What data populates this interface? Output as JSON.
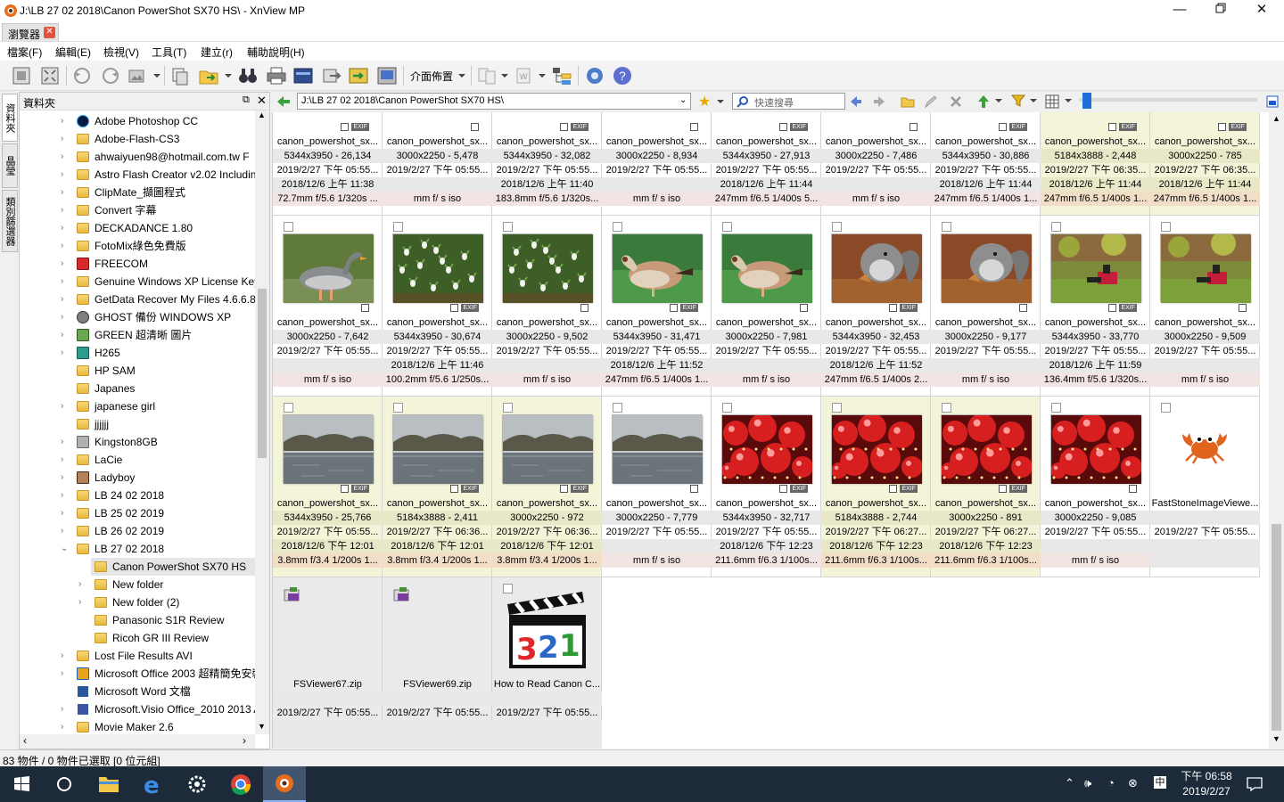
{
  "window": {
    "title": "J:\\LB 27 02 2018\\Canon PowerShot SX70 HS\\ - XnView MP",
    "minimize_icon": "minimize-icon",
    "maximize_icon": "restore-icon",
    "close_icon": "close-icon"
  },
  "tabs": [
    {
      "label": "瀏覽器",
      "close": "✕"
    }
  ],
  "menu": [
    "檔案(F)",
    "編輯(E)",
    "檢視(V)",
    "工具(T)",
    "建立(r)",
    "輔助說明(H)"
  ],
  "toolbar": {
    "layout_label": "介面佈置"
  },
  "side_tabs": [
    "資料夾",
    "晶瑩",
    "類別篩選器"
  ],
  "folder_panel": {
    "title": "資料夾",
    "items": [
      {
        "label": "Adobe Photoshop  CC",
        "icon": "ps-icon",
        "depth": 0,
        "arrow": "›"
      },
      {
        "label": "Adobe-Flash-CS3",
        "icon": "folder-icon",
        "depth": 0,
        "arrow": "›"
      },
      {
        "label": "ahwaiyuen98@hotmail.com.tw  F",
        "icon": "folder-icon",
        "depth": 0,
        "arrow": "›"
      },
      {
        "label": "Astro Flash Creator v2.02  Includin",
        "icon": "folder-icon",
        "depth": 0,
        "arrow": "›"
      },
      {
        "label": "ClipMate_擷圖程式",
        "icon": "folder-icon",
        "depth": 0,
        "arrow": "›"
      },
      {
        "label": "Convert 字幕",
        "icon": "folder-icon",
        "depth": 0,
        "arrow": "›"
      },
      {
        "label": "DECKADANCE 1.80",
        "icon": "folder-icon",
        "depth": 0,
        "arrow": "›"
      },
      {
        "label": "FotoMix綠色免費版",
        "icon": "folder-icon",
        "depth": 0,
        "arrow": "›"
      },
      {
        "label": "FREECOM",
        "icon": "red-icon",
        "depth": 0,
        "arrow": "›"
      },
      {
        "label": "Genuine Windows XP License Key",
        "icon": "folder-icon",
        "depth": 0,
        "arrow": "›"
      },
      {
        "label": "GetData Recover My Files 4.6.6.830",
        "icon": "folder-icon",
        "depth": 0,
        "arrow": "›"
      },
      {
        "label": "GHOST 備份 WINDOWS XP",
        "icon": "ghost-icon",
        "depth": 0,
        "arrow": "›"
      },
      {
        "label": "GREEN 超清晰  圖片",
        "icon": "image-folder-icon",
        "depth": 0,
        "arrow": "›"
      },
      {
        "label": "H265",
        "icon": "h265-icon",
        "depth": 0,
        "arrow": "›"
      },
      {
        "label": "HP SAM",
        "icon": "folder-icon",
        "depth": 0,
        "arrow": ""
      },
      {
        "label": "Japanes",
        "icon": "folder-icon",
        "depth": 0,
        "arrow": ""
      },
      {
        "label": "japanese girl",
        "icon": "folder-icon",
        "depth": 0,
        "arrow": "›"
      },
      {
        "label": "jjjjjj",
        "icon": "folder-icon",
        "depth": 0,
        "arrow": ""
      },
      {
        "label": "Kingston8GB",
        "icon": "drive-icon",
        "depth": 0,
        "arrow": "›"
      },
      {
        "label": "LaCie",
        "icon": "folder-icon",
        "depth": 0,
        "arrow": "›"
      },
      {
        "label": "Ladyboy",
        "icon": "portrait-icon",
        "depth": 0,
        "arrow": "›"
      },
      {
        "label": "LB 24 02 2018",
        "icon": "folder-icon",
        "depth": 0,
        "arrow": "›"
      },
      {
        "label": "LB 25 02 2019",
        "icon": "folder-icon",
        "depth": 0,
        "arrow": "›"
      },
      {
        "label": "LB 26 02 2019",
        "icon": "folder-icon",
        "depth": 0,
        "arrow": "›"
      },
      {
        "label": "LB 27 02 2018",
        "icon": "folder-icon",
        "depth": 0,
        "arrow": "⌄"
      },
      {
        "label": "Canon PowerShot SX70 HS",
        "icon": "folder-icon",
        "depth": 1,
        "arrow": "›",
        "selected": true
      },
      {
        "label": "New folder",
        "icon": "folder-icon",
        "depth": 1,
        "arrow": "›"
      },
      {
        "label": "New folder (2)",
        "icon": "folder-icon",
        "depth": 1,
        "arrow": "›"
      },
      {
        "label": "Panasonic S1R Review",
        "icon": "folder-icon",
        "depth": 1,
        "arrow": ""
      },
      {
        "label": "Ricoh GR III Review",
        "icon": "folder-icon",
        "depth": 1,
        "arrow": ""
      },
      {
        "label": "Lost File Results AVI",
        "icon": "folder-icon",
        "depth": 0,
        "arrow": "›"
      },
      {
        "label": "Microsoft Office 2003 超精簡免安裝",
        "icon": "office-icon",
        "depth": 0,
        "arrow": "›"
      },
      {
        "label": "Microsoft Word 文檔",
        "icon": "word-icon",
        "depth": 0,
        "arrow": ""
      },
      {
        "label": "Microsoft.Visio Office_2010 2013 A",
        "icon": "visio-icon",
        "depth": 0,
        "arrow": "›"
      },
      {
        "label": "Movie Maker 2.6",
        "icon": "folder-icon",
        "depth": 0,
        "arrow": "›"
      }
    ]
  },
  "path": {
    "value": "J:\\LB 27 02 2018\\Canon PowerShot SX70 HS\\",
    "search_placeholder": "快速搜尋"
  },
  "colors": {
    "accent": "#1e6fd9",
    "selected_cell": "#f4f4d8"
  },
  "thumbnails": [
    {
      "row": 0,
      "col": 0,
      "name": "canon_powershot_sx...",
      "dims": "5344x3950 - 26,134",
      "date": "2019/2/27 下午 05:55...",
      "taken": "2018/12/6 上午 11:38",
      "info": "72.7mm f/5.6 1/320s ...",
      "exif": true,
      "img": "none"
    },
    {
      "row": 0,
      "col": 1,
      "name": "canon_powershot_sx...",
      "dims": "3000x2250 - 5,478",
      "date": "2019/2/27 下午 05:55...",
      "taken": "",
      "info": "mm f/ s iso",
      "exif": false,
      "img": "none"
    },
    {
      "row": 0,
      "col": 2,
      "name": "canon_powershot_sx...",
      "dims": "5344x3950 - 32,082",
      "date": "2019/2/27 下午 05:55...",
      "taken": "2018/12/6 上午 11:40",
      "info": "183.8mm f/5.6 1/320s...",
      "exif": true,
      "img": "none"
    },
    {
      "row": 0,
      "col": 3,
      "name": "canon_powershot_sx...",
      "dims": "3000x2250 - 8,934",
      "date": "2019/2/27 下午 05:55...",
      "taken": "",
      "info": "mm f/ s iso",
      "exif": false,
      "img": "none"
    },
    {
      "row": 0,
      "col": 4,
      "name": "canon_powershot_sx...",
      "dims": "5344x3950 - 27,913",
      "date": "2019/2/27 下午 05:55...",
      "taken": "2018/12/6 上午 11:44",
      "info": "247mm f/6.5 1/400s 5...",
      "exif": true,
      "img": "none"
    },
    {
      "row": 0,
      "col": 5,
      "name": "canon_powershot_sx...",
      "dims": "3000x2250 - 7,486",
      "date": "2019/2/27 下午 05:55...",
      "taken": "",
      "info": "mm f/ s iso",
      "exif": false,
      "img": "none"
    },
    {
      "row": 0,
      "col": 6,
      "name": "canon_powershot_sx...",
      "dims": "5344x3950 - 30,886",
      "date": "2019/2/27 下午 05:55...",
      "taken": "2018/12/6 上午 11:44",
      "info": "247mm f/6.5 1/400s 1...",
      "exif": true,
      "img": "none"
    },
    {
      "row": 0,
      "col": 7,
      "name": "canon_powershot_sx...",
      "dims": "5184x3888 - 2,448",
      "date": "2019/2/27 下午 06:35...",
      "taken": "2018/12/6 上午 11:44",
      "info": "247mm f/6.5 1/400s 1...",
      "exif": true,
      "img": "none",
      "selected": true
    },
    {
      "row": 0,
      "col": 8,
      "name": "canon_powershot_sx...",
      "dims": "3000x2250 - 785",
      "date": "2019/2/27 下午 06:35...",
      "taken": "2018/12/6 上午 11:44",
      "info": "247mm f/6.5 1/400s 1...",
      "exif": true,
      "img": "none",
      "selected": true
    },
    {
      "row": 1,
      "col": 0,
      "name": "canon_powershot_sx...",
      "dims": "3000x2250 - 7,642",
      "date": "2019/2/27 下午 05:55...",
      "taken": "",
      "info": "mm f/ s iso",
      "exif": false,
      "img": "goose"
    },
    {
      "row": 1,
      "col": 1,
      "name": "canon_powershot_sx...",
      "dims": "5344x3950 - 30,674",
      "date": "2019/2/27 下午 05:55...",
      "taken": "2018/12/6 上午 11:46",
      "info": "100.2mm f/5.6 1/250s...",
      "exif": true,
      "img": "flowers"
    },
    {
      "row": 1,
      "col": 2,
      "name": "canon_powershot_sx...",
      "dims": "3000x2250 - 9,502",
      "date": "2019/2/27 下午 05:55...",
      "taken": "",
      "info": "mm f/ s iso",
      "exif": false,
      "img": "flowers"
    },
    {
      "row": 1,
      "col": 3,
      "name": "canon_powershot_sx...",
      "dims": "5344x3950 - 31,471",
      "date": "2019/2/27 下午 05:55...",
      "taken": "2018/12/6 上午 11:52",
      "info": "247mm f/6.5 1/400s 1...",
      "exif": true,
      "img": "goose2"
    },
    {
      "row": 1,
      "col": 4,
      "name": "canon_powershot_sx...",
      "dims": "3000x2250 - 7,981",
      "date": "2019/2/27 下午 05:55...",
      "taken": "",
      "info": "mm f/ s iso",
      "exif": false,
      "img": "goose2"
    },
    {
      "row": 1,
      "col": 5,
      "name": "canon_powershot_sx...",
      "dims": "5344x3950 - 32,453",
      "date": "2019/2/27 下午 05:55...",
      "taken": "2018/12/6 上午 11:52",
      "info": "247mm f/6.5 1/400s 2...",
      "exif": true,
      "img": "squirrel"
    },
    {
      "row": 1,
      "col": 6,
      "name": "canon_powershot_sx...",
      "dims": "3000x2250 - 9,177",
      "date": "2019/2/27 下午 05:55...",
      "taken": "",
      "info": "mm f/ s iso",
      "exif": false,
      "img": "squirrel"
    },
    {
      "row": 1,
      "col": 7,
      "name": "canon_powershot_sx...",
      "dims": "5344x3950 - 33,770",
      "date": "2019/2/27 下午 05:55...",
      "taken": "2018/12/6 上午 11:59",
      "info": "136.4mm f/5.6 1/320s...",
      "exif": true,
      "img": "park"
    },
    {
      "row": 1,
      "col": 8,
      "name": "canon_powershot_sx...",
      "dims": "3000x2250 - 9,509",
      "date": "2019/2/27 下午 05:55...",
      "taken": "",
      "info": "mm f/ s iso",
      "exif": false,
      "img": "park"
    },
    {
      "row": 2,
      "col": 0,
      "name": "canon_powershot_sx...",
      "dims": "5344x3950 - 25,766",
      "date": "2019/2/27 下午 05:55...",
      "taken": "2018/12/6 下午 12:01",
      "info": "3.8mm f/3.4 1/200s 1...",
      "exif": true,
      "img": "river",
      "selected": true
    },
    {
      "row": 2,
      "col": 1,
      "name": "canon_powershot_sx...",
      "dims": "5184x3888 - 2,411",
      "date": "2019/2/27 下午 06:36...",
      "taken": "2018/12/6 下午 12:01",
      "info": "3.8mm f/3.4 1/200s 1...",
      "exif": true,
      "img": "river",
      "selected": true
    },
    {
      "row": 2,
      "col": 2,
      "name": "canon_powershot_sx...",
      "dims": "3000x2250 - 972",
      "date": "2019/2/27 下午 06:36...",
      "taken": "2018/12/6 下午 12:01",
      "info": "3.8mm f/3.4 1/200s 1...",
      "exif": true,
      "img": "river",
      "selected": true
    },
    {
      "row": 2,
      "col": 3,
      "name": "canon_powershot_sx...",
      "dims": "3000x2250 - 7,779",
      "date": "2019/2/27 下午 05:55...",
      "taken": "",
      "info": "mm f/ s iso",
      "exif": false,
      "img": "river"
    },
    {
      "row": 2,
      "col": 4,
      "name": "canon_powershot_sx...",
      "dims": "5344x3950 - 32,717",
      "date": "2019/2/27 下午 05:55...",
      "taken": "2018/12/6 下午 12:23",
      "info": "211.6mm f/6.3 1/100s...",
      "exif": true,
      "img": "baubles"
    },
    {
      "row": 2,
      "col": 5,
      "name": "canon_powershot_sx...",
      "dims": "5184x3888 - 2,744",
      "date": "2019/2/27 下午 06:27...",
      "taken": "2018/12/6 下午 12:23",
      "info": "211.6mm f/6.3 1/100s...",
      "exif": true,
      "img": "baubles",
      "selected": true
    },
    {
      "row": 2,
      "col": 6,
      "name": "canon_powershot_sx...",
      "dims": "3000x2250 - 891",
      "date": "2019/2/27 下午 06:27...",
      "taken": "2018/12/6 下午 12:23",
      "info": "211.6mm f/6.3 1/100s...",
      "exif": true,
      "img": "baubles",
      "selected": true
    },
    {
      "row": 2,
      "col": 7,
      "name": "canon_powershot_sx...",
      "dims": "3000x2250 - 9,085",
      "date": "2019/2/27 下午 05:55...",
      "taken": "",
      "info": "mm f/ s iso",
      "exif": false,
      "img": "baubles"
    },
    {
      "row": 2,
      "col": 8,
      "name": "FastStoneImageViewe...",
      "dims": "",
      "date": "2019/2/27 下午 05:55...",
      "taken": "",
      "info": "",
      "exif": false,
      "img": "crab",
      "filecell": true
    },
    {
      "row": 3,
      "col": 0,
      "name": "FSViewer67.zip",
      "dims": "",
      "date": "2019/2/27 下午 05:55...",
      "taken": "",
      "info": "",
      "exif": false,
      "img": "zip",
      "filecell": true
    },
    {
      "row": 3,
      "col": 1,
      "name": "FSViewer69.zip",
      "dims": "",
      "date": "2019/2/27 下午 05:55...",
      "taken": "",
      "info": "",
      "exif": false,
      "img": "zip",
      "filecell": true
    },
    {
      "row": 3,
      "col": 2,
      "name": "How to Read Canon C...",
      "dims": "",
      "date": "2019/2/27 下午 05:55...",
      "taken": "",
      "info": "",
      "exif": false,
      "img": "clapper",
      "filecell": true
    }
  ],
  "status": "83 物件 / 0 物件已選取 [0 位元組]",
  "taskbar": {
    "time": "下午 06:58",
    "date": "2019/2/27",
    "ime": "中"
  }
}
